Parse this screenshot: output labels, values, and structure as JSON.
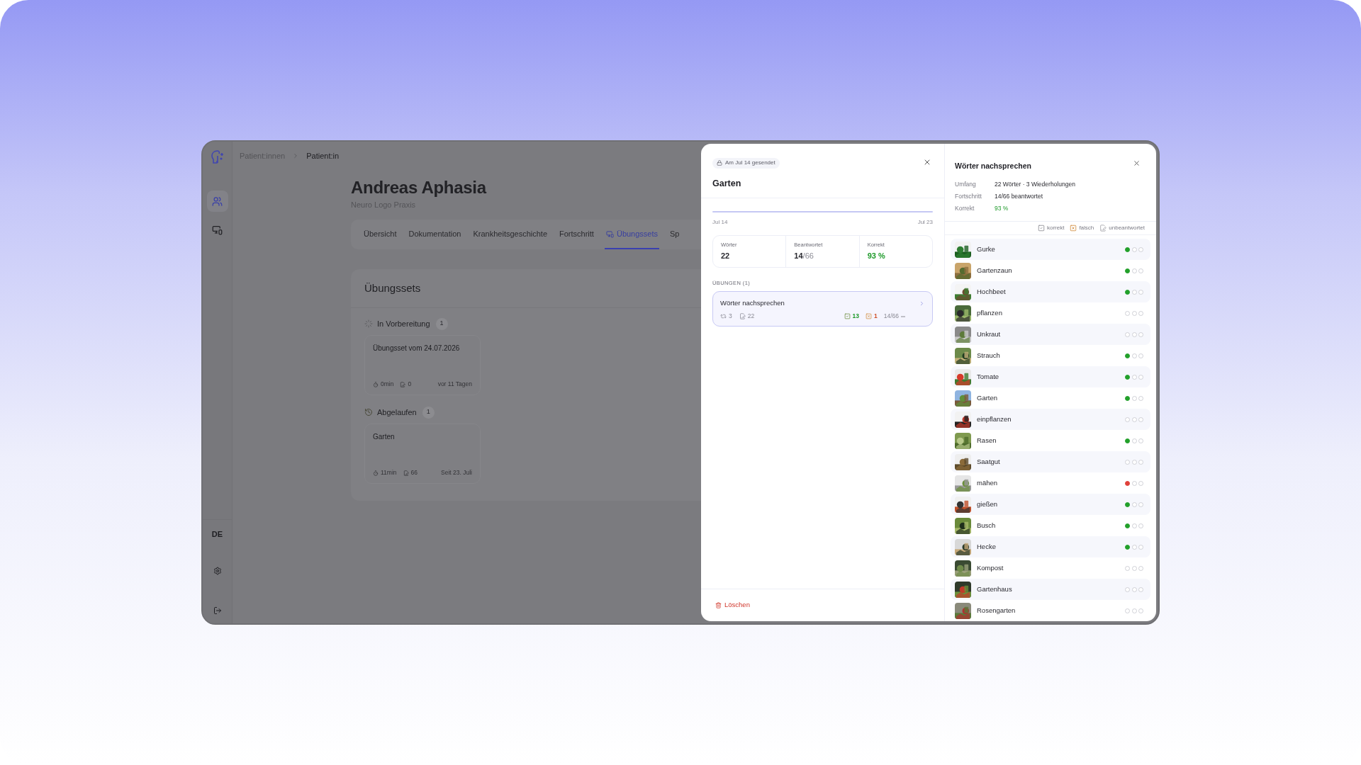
{
  "breadcrumb": [
    {
      "label": "Patient:innen",
      "selected": false
    },
    {
      "label": "Patient:in",
      "selected": true
    }
  ],
  "sidebar": {
    "items": [
      {
        "kind": "users",
        "selected": true
      },
      {
        "kind": "devices",
        "selected": false
      }
    ],
    "language": "DE"
  },
  "patient": {
    "name": "Andreas Aphasia",
    "practice": "Neuro Logo Praxis"
  },
  "tabs": [
    {
      "label": "Übersicht",
      "selected": false
    },
    {
      "label": "Dokumentation",
      "selected": false
    },
    {
      "label": "Krankheitsgeschichte",
      "selected": false
    },
    {
      "label": "Fortschritt",
      "selected": false
    },
    {
      "label": "Übungssets",
      "selected": true
    },
    {
      "label": "Sp",
      "selected": false
    }
  ],
  "exercise_sets": {
    "title": "Übungssets",
    "groups": [
      {
        "kind": "preparation",
        "label": "In Vorbereitung",
        "count": "1",
        "cards": [
          {
            "title": "Übungsset vom 24.07.2026",
            "duration": "0min",
            "words": "0",
            "date": "vor 11 Tagen"
          }
        ]
      },
      {
        "kind": "expired",
        "label": "Abgelaufen",
        "count": "1",
        "cards": [
          {
            "title": "Garten",
            "duration": "11min",
            "words": "66",
            "date": "Seit 23. Juli"
          }
        ]
      }
    ]
  },
  "set_detail": {
    "sent": "Am Jul 14 gesendet",
    "title": "Garten",
    "timeline": {
      "start": "Jul 14",
      "end": "Jul 23"
    },
    "stats": [
      {
        "kind": "plain",
        "label": "Wörter",
        "value": "22"
      },
      {
        "kind": "plain",
        "label": "Beantwortet",
        "value": "14",
        "suffix": "/66"
      },
      {
        "kind": "score",
        "label": "Korrekt",
        "value": "93 %"
      }
    ],
    "exercises_heading": "ÜBUNGEN (1)",
    "exercises": [
      {
        "title": "Wörter nachsprechen",
        "repetitions": "3",
        "words": "22",
        "correct": "13",
        "wrong": "1",
        "progress": "14/66",
        "selected": true
      }
    ],
    "delete": "Löschen"
  },
  "exercise_detail": {
    "title": "Wörter nachsprechen",
    "info": [
      {
        "kind": "plain",
        "label": "Umfang",
        "value": "22 Wörter · 3 Wiederholungen"
      },
      {
        "kind": "plain",
        "label": "Fortschritt",
        "value": "14/66 beantwortet"
      },
      {
        "kind": "score",
        "label": "Korrekt",
        "value": "93 %"
      }
    ],
    "legend": [
      {
        "kind": "correct",
        "label": "korrekt"
      },
      {
        "kind": "wrong",
        "label": "falsch"
      },
      {
        "kind": "open",
        "label": "unbeantwortet"
      }
    ],
    "words": [
      {
        "word": "Gurke",
        "attempts": [
          {
            "answered": true,
            "correct": true
          },
          {
            "answered": false
          },
          {
            "answered": false
          }
        ]
      },
      {
        "word": "Gartenzaun",
        "attempts": [
          {
            "answered": true,
            "correct": true
          },
          {
            "answered": false
          },
          {
            "answered": false
          }
        ]
      },
      {
        "word": "Hochbeet",
        "attempts": [
          {
            "answered": true,
            "correct": true
          },
          {
            "answered": false
          },
          {
            "answered": false
          }
        ]
      },
      {
        "word": "pflanzen",
        "attempts": [
          {
            "answered": false
          },
          {
            "answered": false
          },
          {
            "answered": false
          }
        ]
      },
      {
        "word": "Unkraut",
        "attempts": [
          {
            "answered": false
          },
          {
            "answered": false
          },
          {
            "answered": false
          }
        ]
      },
      {
        "word": "Strauch",
        "attempts": [
          {
            "answered": true,
            "correct": true
          },
          {
            "answered": false
          },
          {
            "answered": false
          }
        ]
      },
      {
        "word": "Tomate",
        "attempts": [
          {
            "answered": true,
            "correct": true
          },
          {
            "answered": false
          },
          {
            "answered": false
          }
        ]
      },
      {
        "word": "Garten",
        "attempts": [
          {
            "answered": true,
            "correct": true
          },
          {
            "answered": false
          },
          {
            "answered": false
          }
        ]
      },
      {
        "word": "einpflanzen",
        "attempts": [
          {
            "answered": false
          },
          {
            "answered": false
          },
          {
            "answered": false
          }
        ]
      },
      {
        "word": "Rasen",
        "attempts": [
          {
            "answered": true,
            "correct": true
          },
          {
            "answered": false
          },
          {
            "answered": false
          }
        ]
      },
      {
        "word": "Saatgut",
        "attempts": [
          {
            "answered": false
          },
          {
            "answered": false
          },
          {
            "answered": false
          }
        ]
      },
      {
        "word": "mähen",
        "attempts": [
          {
            "answered": true,
            "correct": false
          },
          {
            "answered": false
          },
          {
            "answered": false
          }
        ]
      },
      {
        "word": "gießen",
        "attempts": [
          {
            "answered": true,
            "correct": true
          },
          {
            "answered": false
          },
          {
            "answered": false
          }
        ]
      },
      {
        "word": "Busch",
        "attempts": [
          {
            "answered": true,
            "correct": true
          },
          {
            "answered": false
          },
          {
            "answered": false
          }
        ]
      },
      {
        "word": "Hecke",
        "attempts": [
          {
            "answered": true,
            "correct": true
          },
          {
            "answered": false
          },
          {
            "answered": false
          }
        ]
      },
      {
        "word": "Kompost",
        "attempts": [
          {
            "answered": false
          },
          {
            "answered": false
          },
          {
            "answered": false
          }
        ]
      },
      {
        "word": "Gartenhaus",
        "attempts": [
          {
            "answered": false
          },
          {
            "answered": false
          },
          {
            "answered": false
          }
        ]
      },
      {
        "word": "Rosengarten",
        "attempts": [
          {
            "answered": false
          },
          {
            "answered": false
          },
          {
            "answered": false
          }
        ]
      }
    ]
  }
}
